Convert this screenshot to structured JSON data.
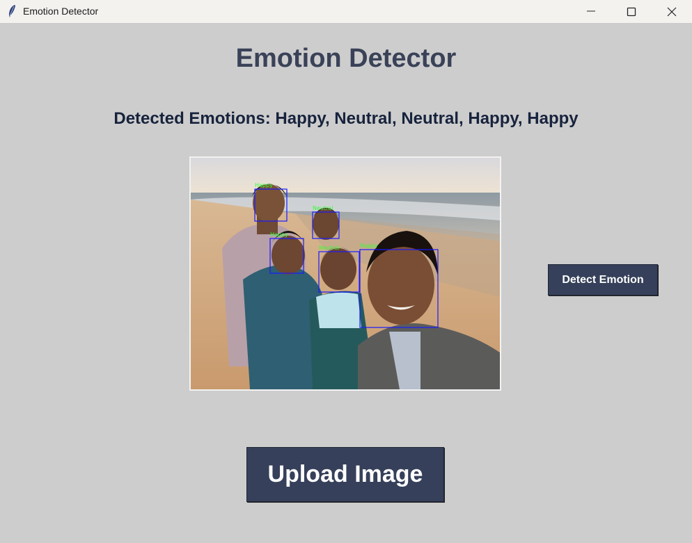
{
  "window": {
    "title": "Emotion Detector",
    "controls": [
      "minimize",
      "maximize",
      "close"
    ]
  },
  "header": {
    "title": "Emotion Detector"
  },
  "result": {
    "text": "Detected Emotions: Happy, Neutral, Neutral, Happy, Happy"
  },
  "image": {
    "description_icon": "annotated-group-photo",
    "face_labels": [
      "Happy",
      "Neutral",
      "Happy",
      "Neutral",
      "Happy"
    ]
  },
  "buttons": {
    "detect_label": "Detect Emotion",
    "upload_label": "Upload Image"
  },
  "colors": {
    "background": "#cdcdcd",
    "button": "#36405a",
    "heading": "#3a4258",
    "face_box": "#1a1aff",
    "face_label": "#32ff32"
  }
}
